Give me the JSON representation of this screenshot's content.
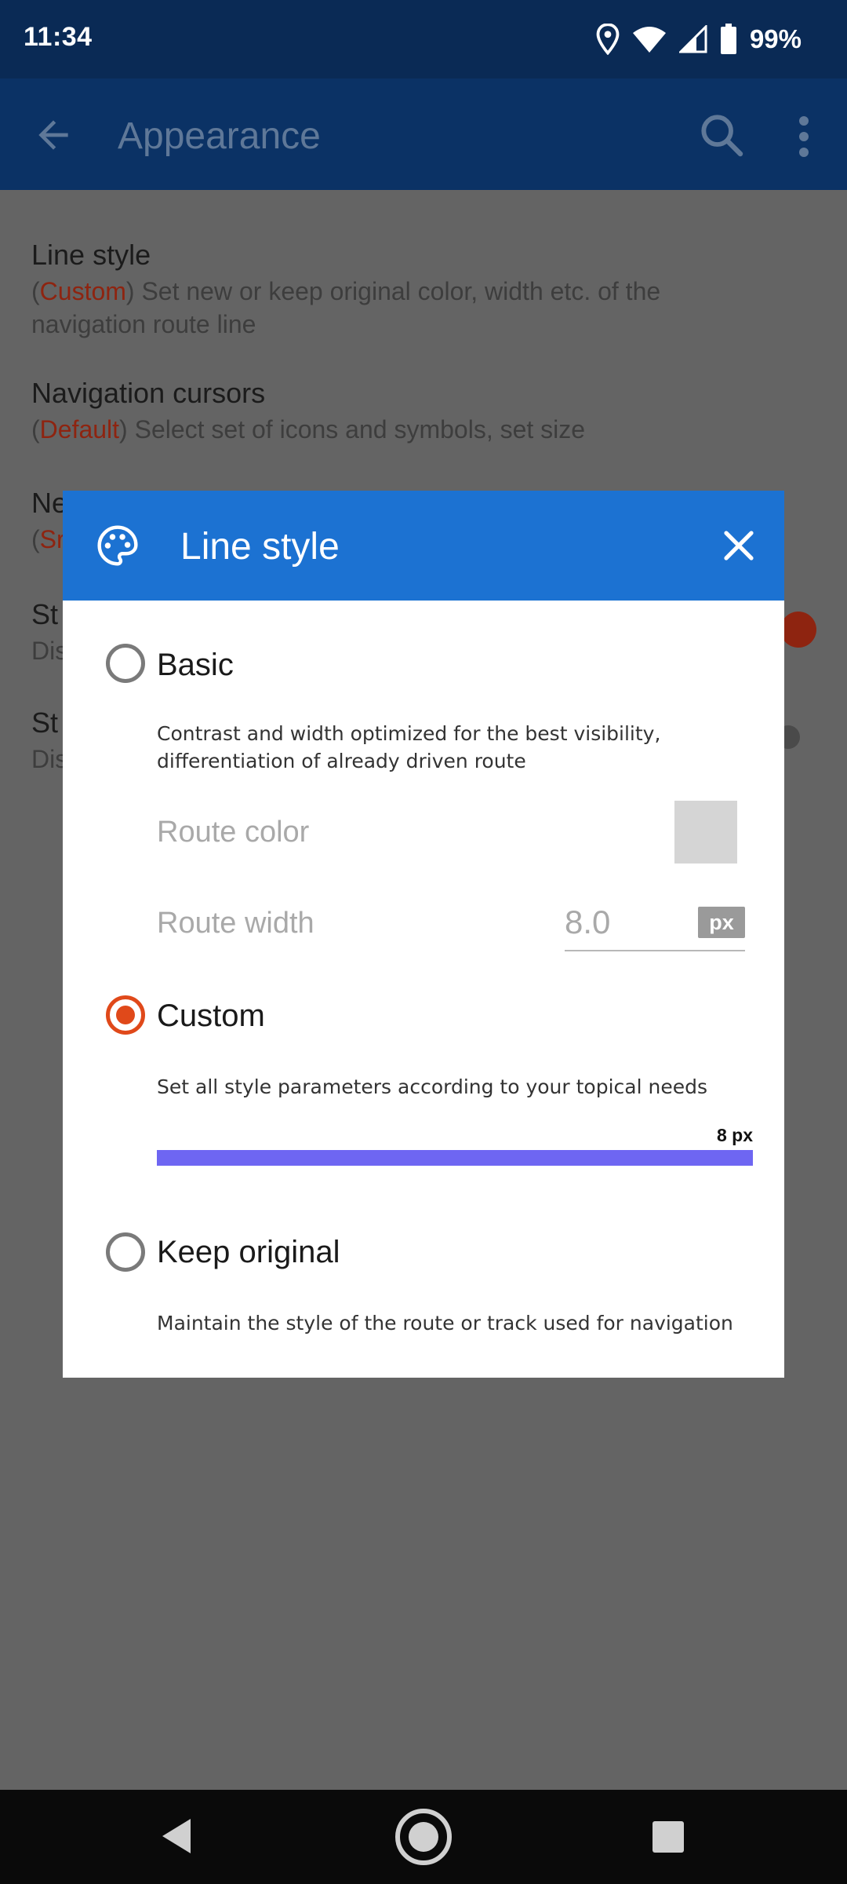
{
  "status_bar": {
    "time": "11:34",
    "battery_percent": "99%",
    "icons": [
      "location-icon",
      "wifi-icon",
      "signal-icon",
      "battery-icon"
    ]
  },
  "app_bar": {
    "title": "Appearance",
    "icons": [
      "back-arrow-icon",
      "search-icon",
      "more-vert-icon"
    ]
  },
  "background_list": {
    "items": [
      {
        "title": "Line style",
        "value": "Custom",
        "summary_prefix": "(",
        "summary_rest": ") Set new or keep original color, width etc. of the",
        "summary_line2": "navigation route line"
      },
      {
        "title": "Navigation cursors",
        "value": "Default",
        "summary_prefix": "(",
        "summary_rest": ") Select set of icons and symbols, set size"
      },
      {
        "title": "Ne",
        "summary_prefix": "(",
        "value": "Sr"
      },
      {
        "title": "St",
        "summary": "Dis"
      },
      {
        "title": "St",
        "summary": "Dis"
      }
    ]
  },
  "dialog": {
    "title": "Line style",
    "options": [
      {
        "label": "Basic",
        "checked": false,
        "description": "Contrast and width optimized for the best visibility, differentiation of already driven route"
      },
      {
        "label": "Custom",
        "checked": true,
        "description": "Set all style parameters according to your topical needs"
      },
      {
        "label": "Keep original",
        "checked": false,
        "description": "Maintain the style of the route or track used for navigation"
      }
    ],
    "basic_settings": {
      "route_color_label": "Route color",
      "route_color": "#d5d5d5",
      "route_width_label": "Route width",
      "route_width_value": "8.0",
      "route_width_unit": "px"
    },
    "custom_preview": {
      "width_caption": "8 px",
      "line_color": "#6e66f2"
    }
  },
  "colors": {
    "status_bar": "#0a2a55",
    "dialog_header": "#1c72d2",
    "accent": "#e0491a",
    "scrim_background": "#646464"
  }
}
